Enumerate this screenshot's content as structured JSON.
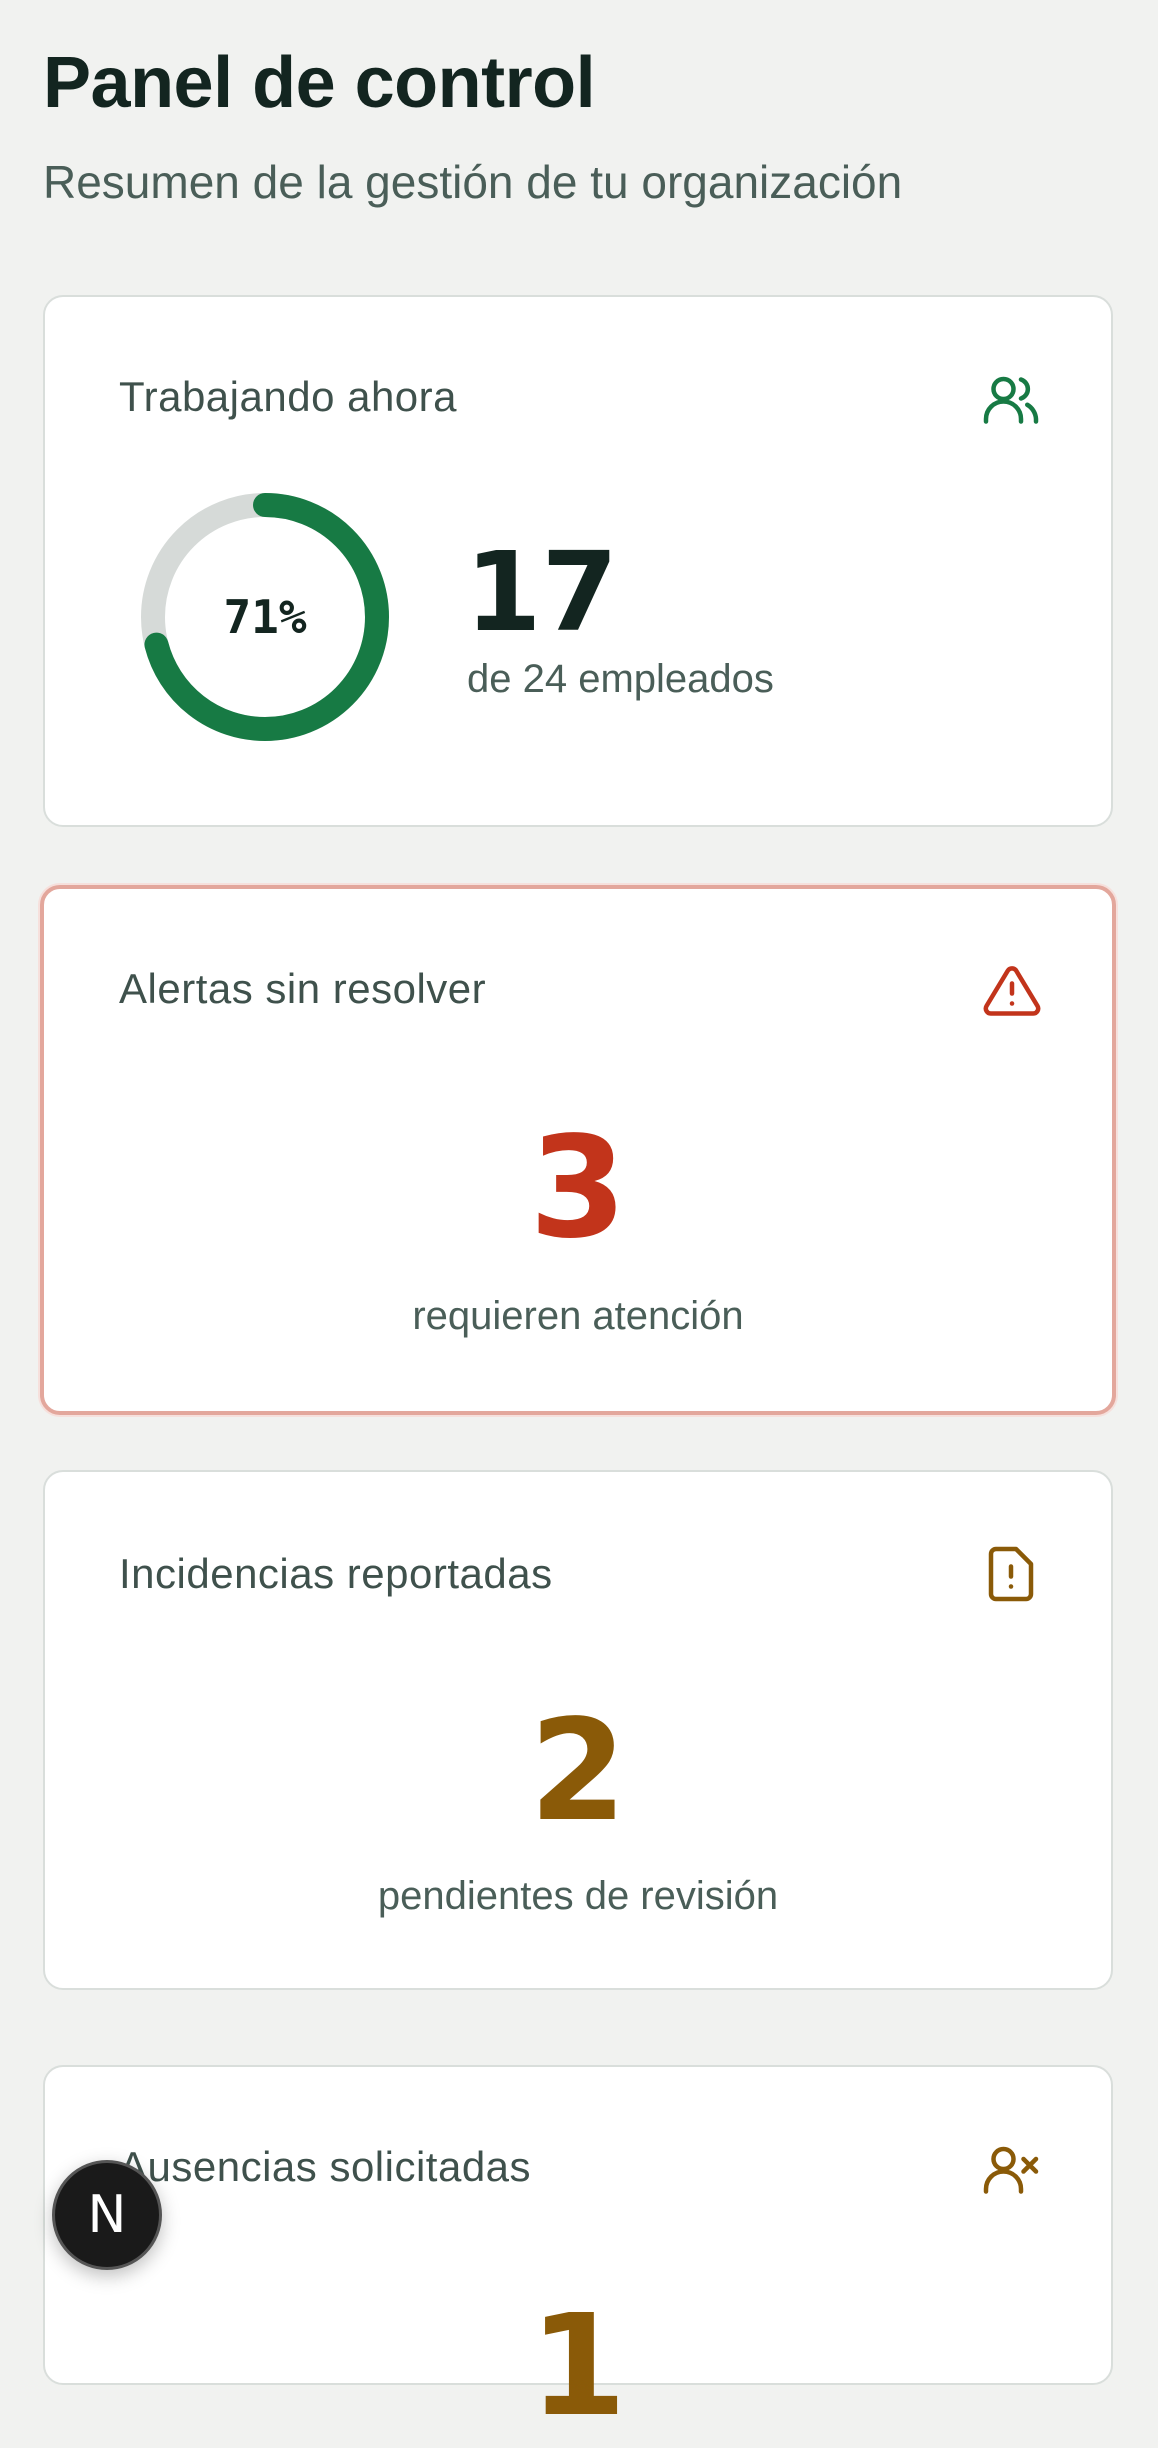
{
  "header": {
    "title": "Panel de control",
    "subtitle": "Resumen de la gestión de tu organización"
  },
  "working_now": {
    "label": "Trabajando ahora",
    "icon": "users-icon",
    "percent_label": "71%",
    "percent": 0.71,
    "count": "17",
    "sub": "de 24 empleados",
    "color": "#177a44"
  },
  "alerts": {
    "label": "Alertas sin resolver",
    "icon": "warning-triangle-icon",
    "count": "3",
    "sub": "requieren atención",
    "color": "#c2341b"
  },
  "incidents": {
    "label": "Incidencias reportadas",
    "icon": "file-alert-icon",
    "count": "2",
    "sub": "pendientes de revisión",
    "color": "#8a5a08"
  },
  "absences": {
    "label": "Ausencias solicitadas",
    "icon": "user-x-icon",
    "count": "1",
    "color": "#8a5a08"
  },
  "badge": {
    "letter": "N"
  }
}
